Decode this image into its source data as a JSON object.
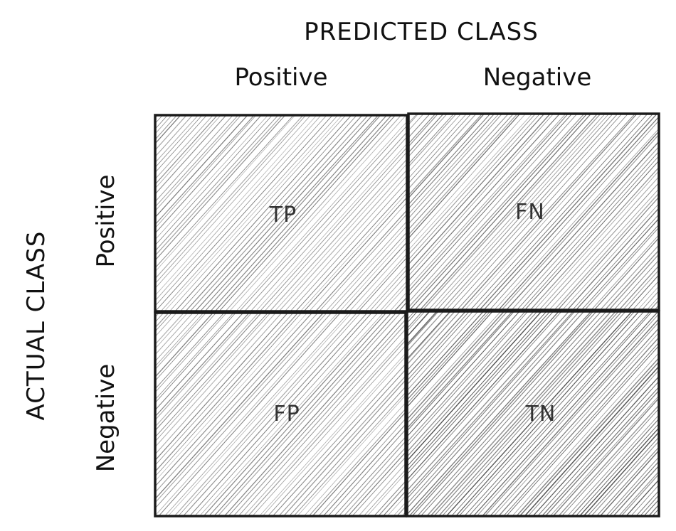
{
  "diagram": {
    "predicted_title": "PREDICTED CLASS",
    "actual_title": "ACTUAL CLASS",
    "predicted_labels": [
      "Positive",
      "Negative"
    ],
    "actual_labels": [
      "Positive",
      "Negative"
    ],
    "cells": [
      {
        "label": "TP"
      },
      {
        "label": "FN"
      },
      {
        "label": "FP"
      },
      {
        "label": "TN"
      }
    ],
    "colors": {
      "ink": "#111111",
      "hatch": "#222222",
      "background": "#ffffff"
    }
  }
}
